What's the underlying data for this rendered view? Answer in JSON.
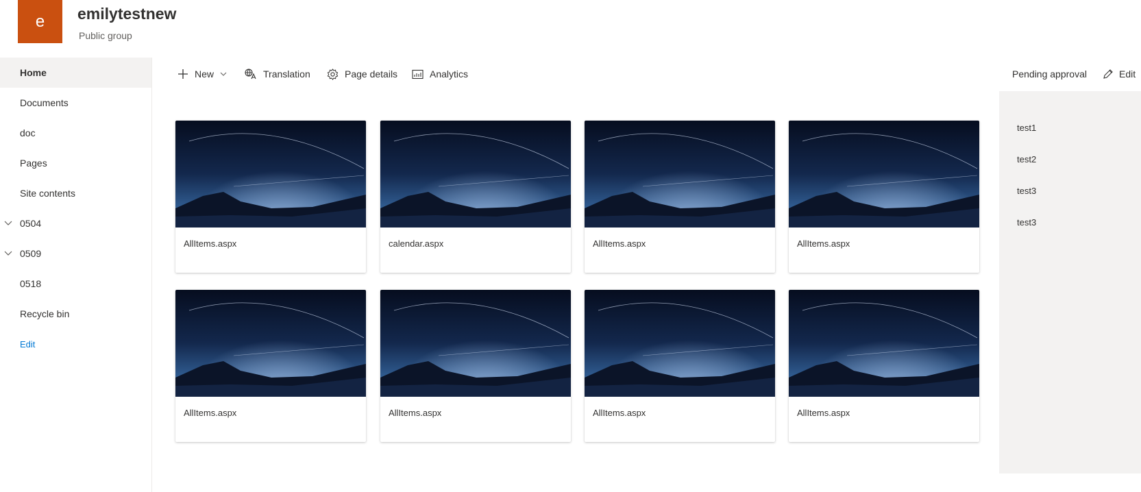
{
  "site": {
    "logo_letter": "e",
    "title": "emilytestnew",
    "subtitle": "Public group",
    "accent": "#ca5010"
  },
  "nav": {
    "items": [
      {
        "label": "Home",
        "selected": true
      },
      {
        "label": "Documents"
      },
      {
        "label": "doc"
      },
      {
        "label": "Pages"
      },
      {
        "label": "Site contents"
      },
      {
        "label": "0504",
        "expandable": true
      },
      {
        "label": "0509",
        "expandable": true
      },
      {
        "label": "0518"
      },
      {
        "label": "Recycle bin"
      },
      {
        "label": "Edit",
        "link": true
      }
    ]
  },
  "commandbar": {
    "new_label": "New",
    "translation_label": "Translation",
    "page_details_label": "Page details",
    "analytics_label": "Analytics",
    "pending_label": "Pending approval",
    "edit_label": "Edit"
  },
  "cards": [
    {
      "label": "AllItems.aspx"
    },
    {
      "label": "calendar.aspx"
    },
    {
      "label": "AllItems.aspx"
    },
    {
      "label": "AllItems.aspx"
    },
    {
      "label": "AllItems.aspx"
    },
    {
      "label": "AllItems.aspx"
    },
    {
      "label": "AllItems.aspx"
    },
    {
      "label": "AllItems.aspx"
    }
  ],
  "side_panel": {
    "items": [
      "test1",
      "test2",
      "test3",
      "test3"
    ]
  }
}
